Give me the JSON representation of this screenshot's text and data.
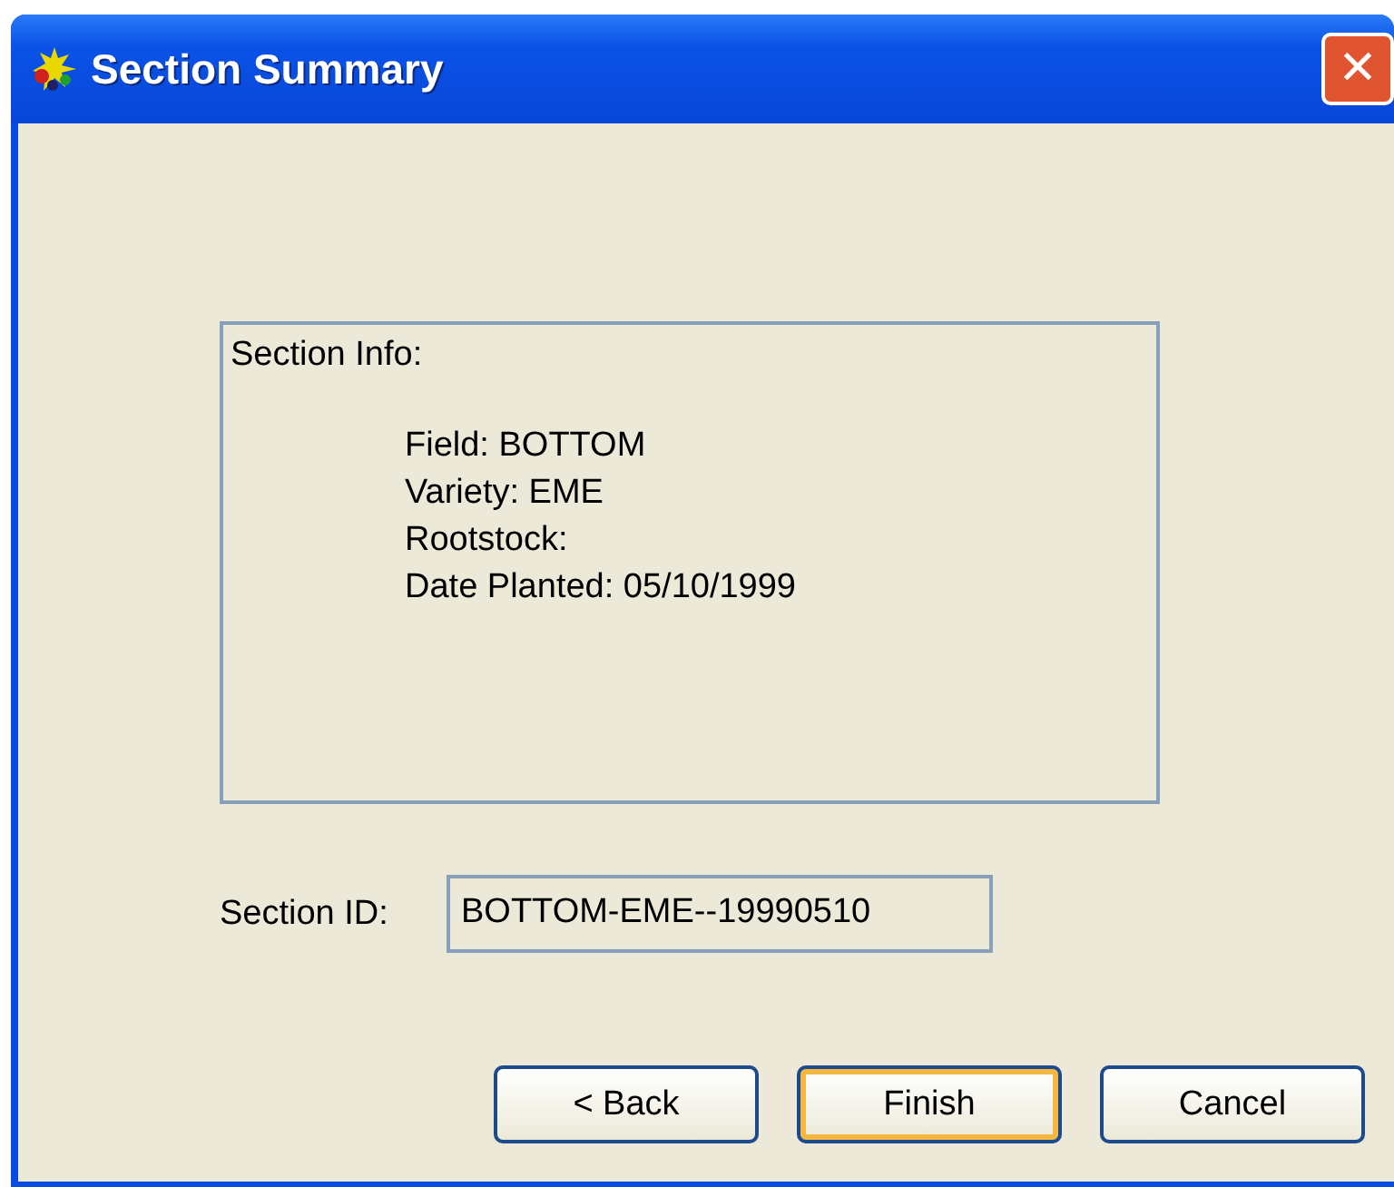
{
  "window": {
    "title": "Section Summary",
    "close": "✕"
  },
  "info": {
    "heading": "Section Info:",
    "lines": [
      "Field:  BOTTOM",
      "Variety:  EME",
      "Rootstock:",
      "Date Planted:  05/10/1999"
    ]
  },
  "section_id": {
    "label": "Section ID:",
    "value": "BOTTOM-EME--19990510"
  },
  "buttons": [
    {
      "label": "< Back",
      "default": false
    },
    {
      "label": "Finish",
      "default": true
    },
    {
      "label": "Cancel",
      "default": false
    }
  ]
}
